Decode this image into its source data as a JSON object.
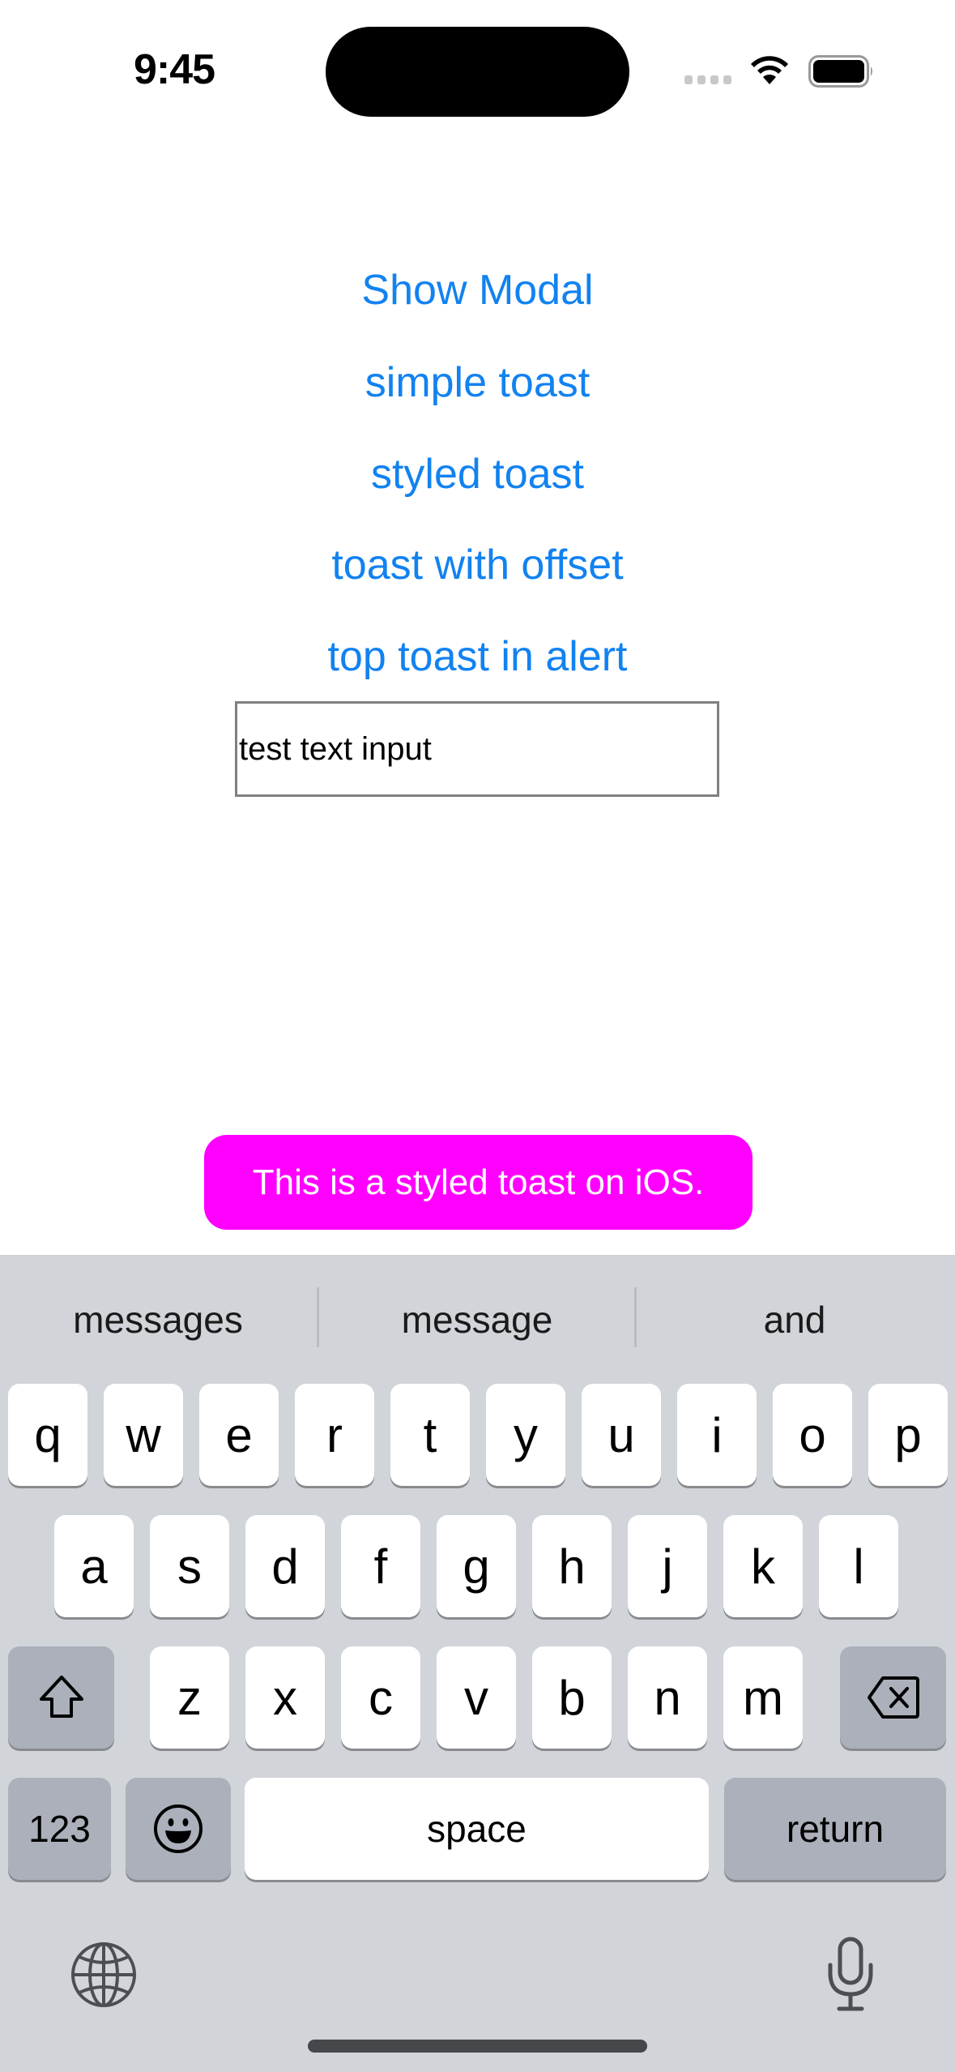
{
  "status_bar": {
    "time": "9:45",
    "icons": [
      "cellular-signal-icon",
      "wifi-icon",
      "battery-icon"
    ]
  },
  "main": {
    "buttons": [
      {
        "label": "Show Modal"
      },
      {
        "label": "simple toast"
      },
      {
        "label": "styled toast"
      },
      {
        "label": "toast with offset"
      },
      {
        "label": "top toast in alert"
      }
    ],
    "text_input": {
      "value": "test text input",
      "placeholder": ""
    },
    "accent_color": "#1282F0"
  },
  "toast": {
    "message": "This is a styled toast on iOS.",
    "background_color": "#FF00FF",
    "text_color": "#FFFFFF"
  },
  "keyboard": {
    "suggestions": [
      "messages",
      "message",
      "and"
    ],
    "rows": [
      [
        "q",
        "w",
        "e",
        "r",
        "t",
        "y",
        "u",
        "i",
        "o",
        "p"
      ],
      [
        "a",
        "s",
        "d",
        "f",
        "g",
        "h",
        "j",
        "k",
        "l"
      ],
      [
        "z",
        "x",
        "c",
        "v",
        "b",
        "n",
        "m"
      ]
    ],
    "shift_icon": "shift-icon",
    "delete_icon": "delete-icon",
    "numbers_label": "123",
    "emoji_icon": "emoji-icon",
    "space_label": "space",
    "return_label": "return",
    "globe_icon": "globe-icon",
    "mic_icon": "microphone-icon",
    "background_color": "#D1D4D9",
    "special_key_color": "#ABB0BA"
  }
}
